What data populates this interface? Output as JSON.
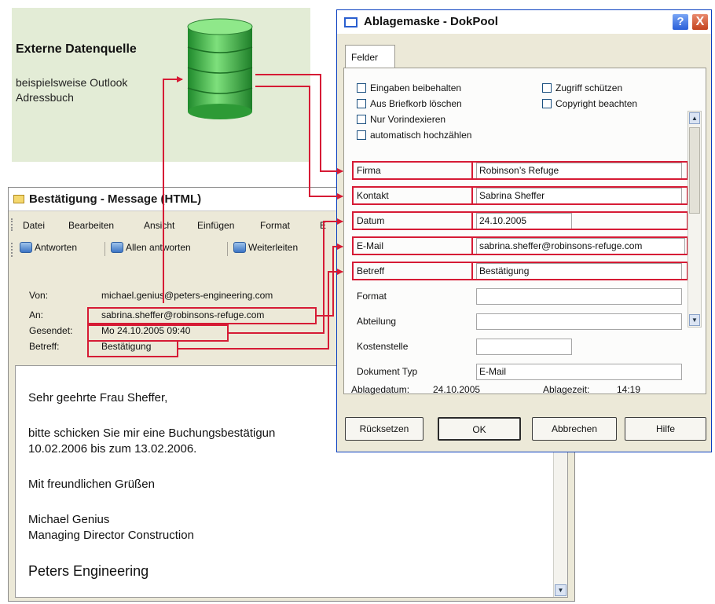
{
  "external_source": {
    "title": "Externe Datenquelle",
    "subtitle": "beispielsweise Outlook Adressbuch"
  },
  "message_window": {
    "title": "Bestätigung - Message (HTML)",
    "menu": [
      "Datei",
      "Bearbeiten",
      "Ansicht",
      "Einfügen",
      "Format",
      "E"
    ],
    "toolbar": [
      "Antworten",
      "Allen antworten",
      "Weiterleiten"
    ],
    "header": {
      "from_label": "Von:",
      "from_value": "michael.genius@peters-engineering.com",
      "to_label": "An:",
      "to_value": "sabrina.sheffer@robinsons-refuge.com",
      "sent_label": "Gesendet:",
      "sent_value": "Mo 24.10.2005 09:40",
      "subject_label": "Betreff:",
      "subject_value": "Bestätigung"
    },
    "body": {
      "greeting": "Sehr geehrte Frau Sheffer,",
      "line1": "bitte schicken Sie mir eine Buchungsbestätigun",
      "line2": "10.02.2006 bis zum 13.02.2006.",
      "closing": "Mit freundlichen Grüßen",
      "name": "Michael Genius",
      "role": "Managing Director Construction",
      "company": "Peters Engineering"
    }
  },
  "dialog": {
    "title": "Ablagemaske - DokPool",
    "help_glyph": "?",
    "close_glyph": "X",
    "tab": "Felder",
    "checkboxes": [
      "Eingaben beibehalten",
      "Zugriff schützen",
      "Aus Briefkorb löschen",
      "Copyright beachten",
      "Nur Vorindexieren",
      "automatisch hochzählen"
    ],
    "fields": [
      {
        "label": "Firma",
        "value": "Robinson’s Refuge"
      },
      {
        "label": "Kontakt",
        "value": "Sabrina Sheffer"
      },
      {
        "label": "Datum",
        "value": "24.10.2005"
      },
      {
        "label": "E-Mail",
        "value": "sabrina.sheffer@robinsons-refuge.com"
      },
      {
        "label": "Betreff",
        "value": "Bestätigung"
      },
      {
        "label": "Format",
        "value": ""
      },
      {
        "label": "Abteilung",
        "value": ""
      },
      {
        "label": "Kostenstelle",
        "value": ""
      },
      {
        "label": "Dokument Typ",
        "value": "E-Mail"
      }
    ],
    "footer": {
      "date_label": "Ablagedatum:",
      "date_value": "24.10.2005",
      "time_label": "Ablagezeit:",
      "time_value": "14:19"
    },
    "buttons": {
      "reset": "Rücksetzen",
      "ok": "OK",
      "cancel": "Abbrechen",
      "help": "Hilfe"
    }
  },
  "colors": {
    "highlight": "#d61b35",
    "panel_green": "#e3ecd6",
    "database_green": "#3fb84a"
  }
}
